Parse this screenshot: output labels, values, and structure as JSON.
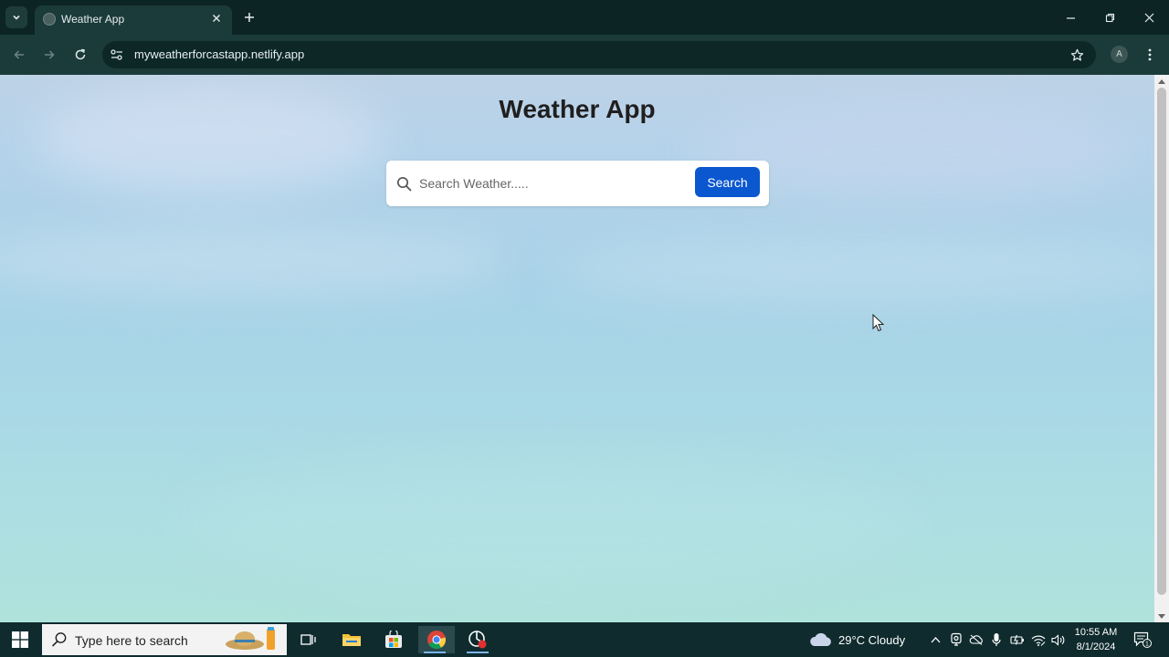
{
  "browser": {
    "tab_title": "Weather App",
    "url": "myweatherforcastapp.netlify.app",
    "profile_initial": "A"
  },
  "page": {
    "title": "Weather App",
    "search": {
      "placeholder": "Search Weather.....",
      "value": "",
      "button_label": "Search"
    }
  },
  "taskbar": {
    "search_placeholder": "Type here to search",
    "weather": "29°C  Cloudy",
    "time": "10:55 AM",
    "date": "8/1/2024",
    "notification_count": "1"
  },
  "colors": {
    "accent": "#0b57d0",
    "chrome": "#1b3a3a",
    "tabbar": "#0c2424",
    "taskbar": "#0f2b2e"
  }
}
